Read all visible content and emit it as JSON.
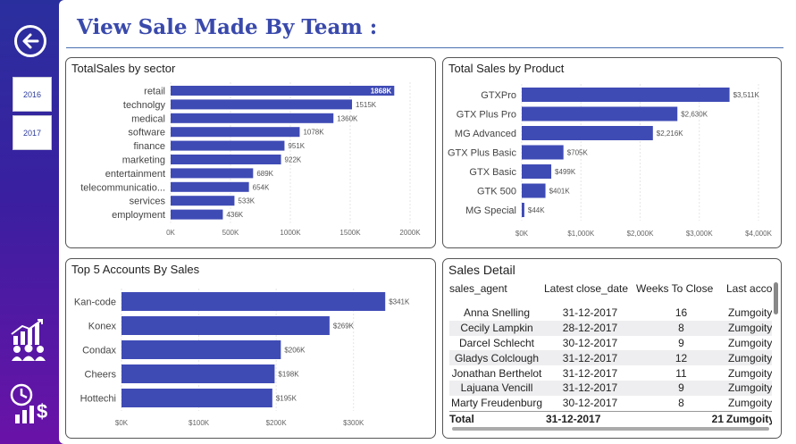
{
  "page_title": "View Sale Made By Team :",
  "sidebar": {
    "back_icon": "back-arrow-icon",
    "years": [
      "2016",
      "2017"
    ],
    "bottom_icons": [
      "team-growth-icon",
      "sales-time-money-icon"
    ]
  },
  "colors": {
    "bar": "#3f4bb5",
    "title": "#3949ab",
    "sidebar_top": "#2a2f9e",
    "sidebar_bottom": "#6a12a8"
  },
  "cards": {
    "sector": {
      "title": "TotalSales by sector"
    },
    "product": {
      "title": "Total Sales by Product"
    },
    "accounts": {
      "title": "Top 5 Accounts By Sales"
    },
    "detail": {
      "title": "Sales Detail"
    }
  },
  "chart_data": [
    {
      "type": "bar",
      "orientation": "horizontal",
      "title": "TotalSales by sector",
      "categories": [
        "retail",
        "technolgy",
        "medical",
        "software",
        "finance",
        "marketing",
        "entertainment",
        "telecommunicatio...",
        "services",
        "employment"
      ],
      "values": [
        1868,
        1515,
        1360,
        1078,
        951,
        922,
        689,
        654,
        533,
        436
      ],
      "labels": [
        "1868K",
        "1515K",
        "1360K",
        "1078K",
        "951K",
        "922K",
        "689K",
        "654K",
        "533K",
        "436K"
      ],
      "xlim": [
        0,
        2000
      ],
      "xticks": [
        "0K",
        "500K",
        "1000K",
        "1500K",
        "2000K"
      ],
      "grid": true
    },
    {
      "type": "bar",
      "orientation": "horizontal",
      "title": "Total Sales by Product",
      "categories": [
        "GTXPro",
        "GTX Plus Pro",
        "MG Advanced",
        "GTX Plus Basic",
        "GTX Basic",
        "GTK 500",
        "MG Special"
      ],
      "values": [
        3511,
        2630,
        2216,
        705,
        499,
        401,
        44
      ],
      "labels": [
        "$3,511K",
        "$2,630K",
        "$2,216K",
        "$705K",
        "$499K",
        "$401K",
        "$44K"
      ],
      "xlim": [
        0,
        4000
      ],
      "xticks": [
        "$0K",
        "$1,000K",
        "$2,000K",
        "$3,000K",
        "$4,000K"
      ],
      "grid": true
    },
    {
      "type": "bar",
      "orientation": "horizontal",
      "title": "Top 5 Accounts By Sales",
      "categories": [
        "Kan-code",
        "Konex",
        "Condax",
        "Cheers",
        "Hottechi"
      ],
      "values": [
        341,
        269,
        206,
        198,
        195
      ],
      "labels": [
        "$341K",
        "$269K",
        "$206K",
        "$198K",
        "$195K"
      ],
      "xlim": [
        0,
        350
      ],
      "xticks": [
        "$0K",
        "$100K",
        "$200K",
        "$300K"
      ],
      "grid": true
    }
  ],
  "sales_detail": {
    "headers": [
      "sales_agent",
      "Latest close_date",
      "Weeks To Close",
      "Last acco"
    ],
    "rows": [
      [
        "Anna Snelling",
        "31-12-2017",
        "16",
        "Zumgoity"
      ],
      [
        "Cecily Lampkin",
        "28-12-2017",
        "8",
        "Zumgoity"
      ],
      [
        "Darcel Schlecht",
        "30-12-2017",
        "9",
        "Zumgoity"
      ],
      [
        "Gladys Colclough",
        "31-12-2017",
        "12",
        "Zumgoity"
      ],
      [
        "Jonathan Berthelot",
        "31-12-2017",
        "11",
        "Zumgoity"
      ],
      [
        "Lajuana Vencill",
        "31-12-2017",
        "9",
        "Zumgoity"
      ],
      [
        "Marty Freudenburg",
        "30-12-2017",
        "8",
        "Zumgoity"
      ]
    ],
    "total": [
      "Total",
      "31-12-2017",
      "21",
      "Zumgoity"
    ]
  }
}
